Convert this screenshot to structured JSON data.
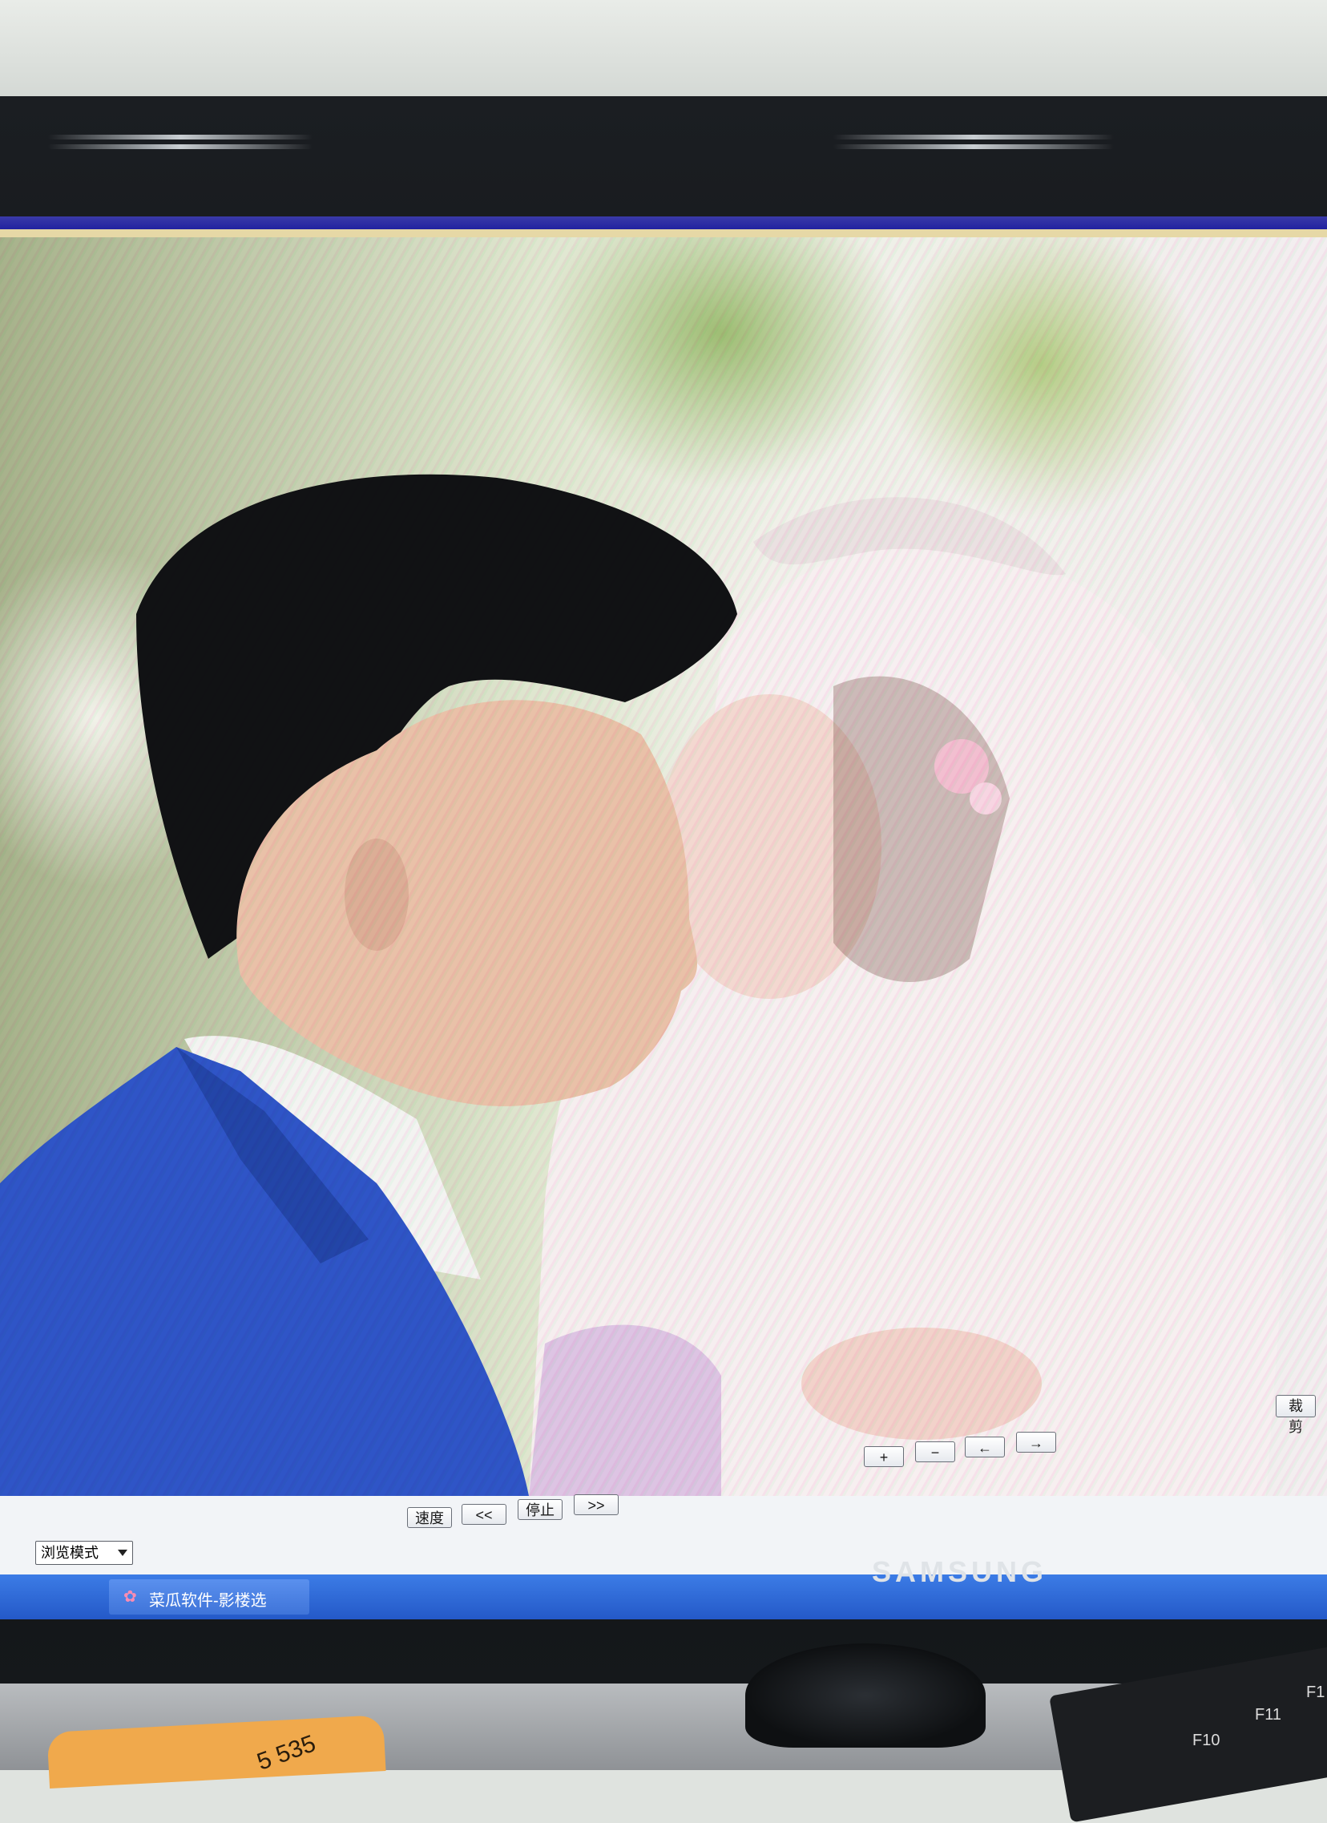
{
  "app": {
    "photo": {
      "subject": "wedding-couple"
    },
    "toolbar": {
      "crop_label": "裁剪",
      "zoom_in_label": "+",
      "zoom_out_label": "−",
      "prev_label": "←",
      "next_label": "→",
      "speed_label": "速度",
      "rewind_label": "<<",
      "stop_label": "停止",
      "forward_label": ">>"
    },
    "mode_select": {
      "value": "浏览模式"
    }
  },
  "taskbar": {
    "active_item_label": "菜瓜软件-影楼选"
  },
  "monitor": {
    "brand": "SAMSUNG"
  },
  "keyboard": {
    "keys": [
      "F10",
      "F11",
      "F1"
    ]
  },
  "desk": {
    "sticker_text": "5  535"
  },
  "colors": {
    "suit": "#2f55c7",
    "taskbar": "#2f66d6",
    "window_bar": "#2b2bb0"
  }
}
